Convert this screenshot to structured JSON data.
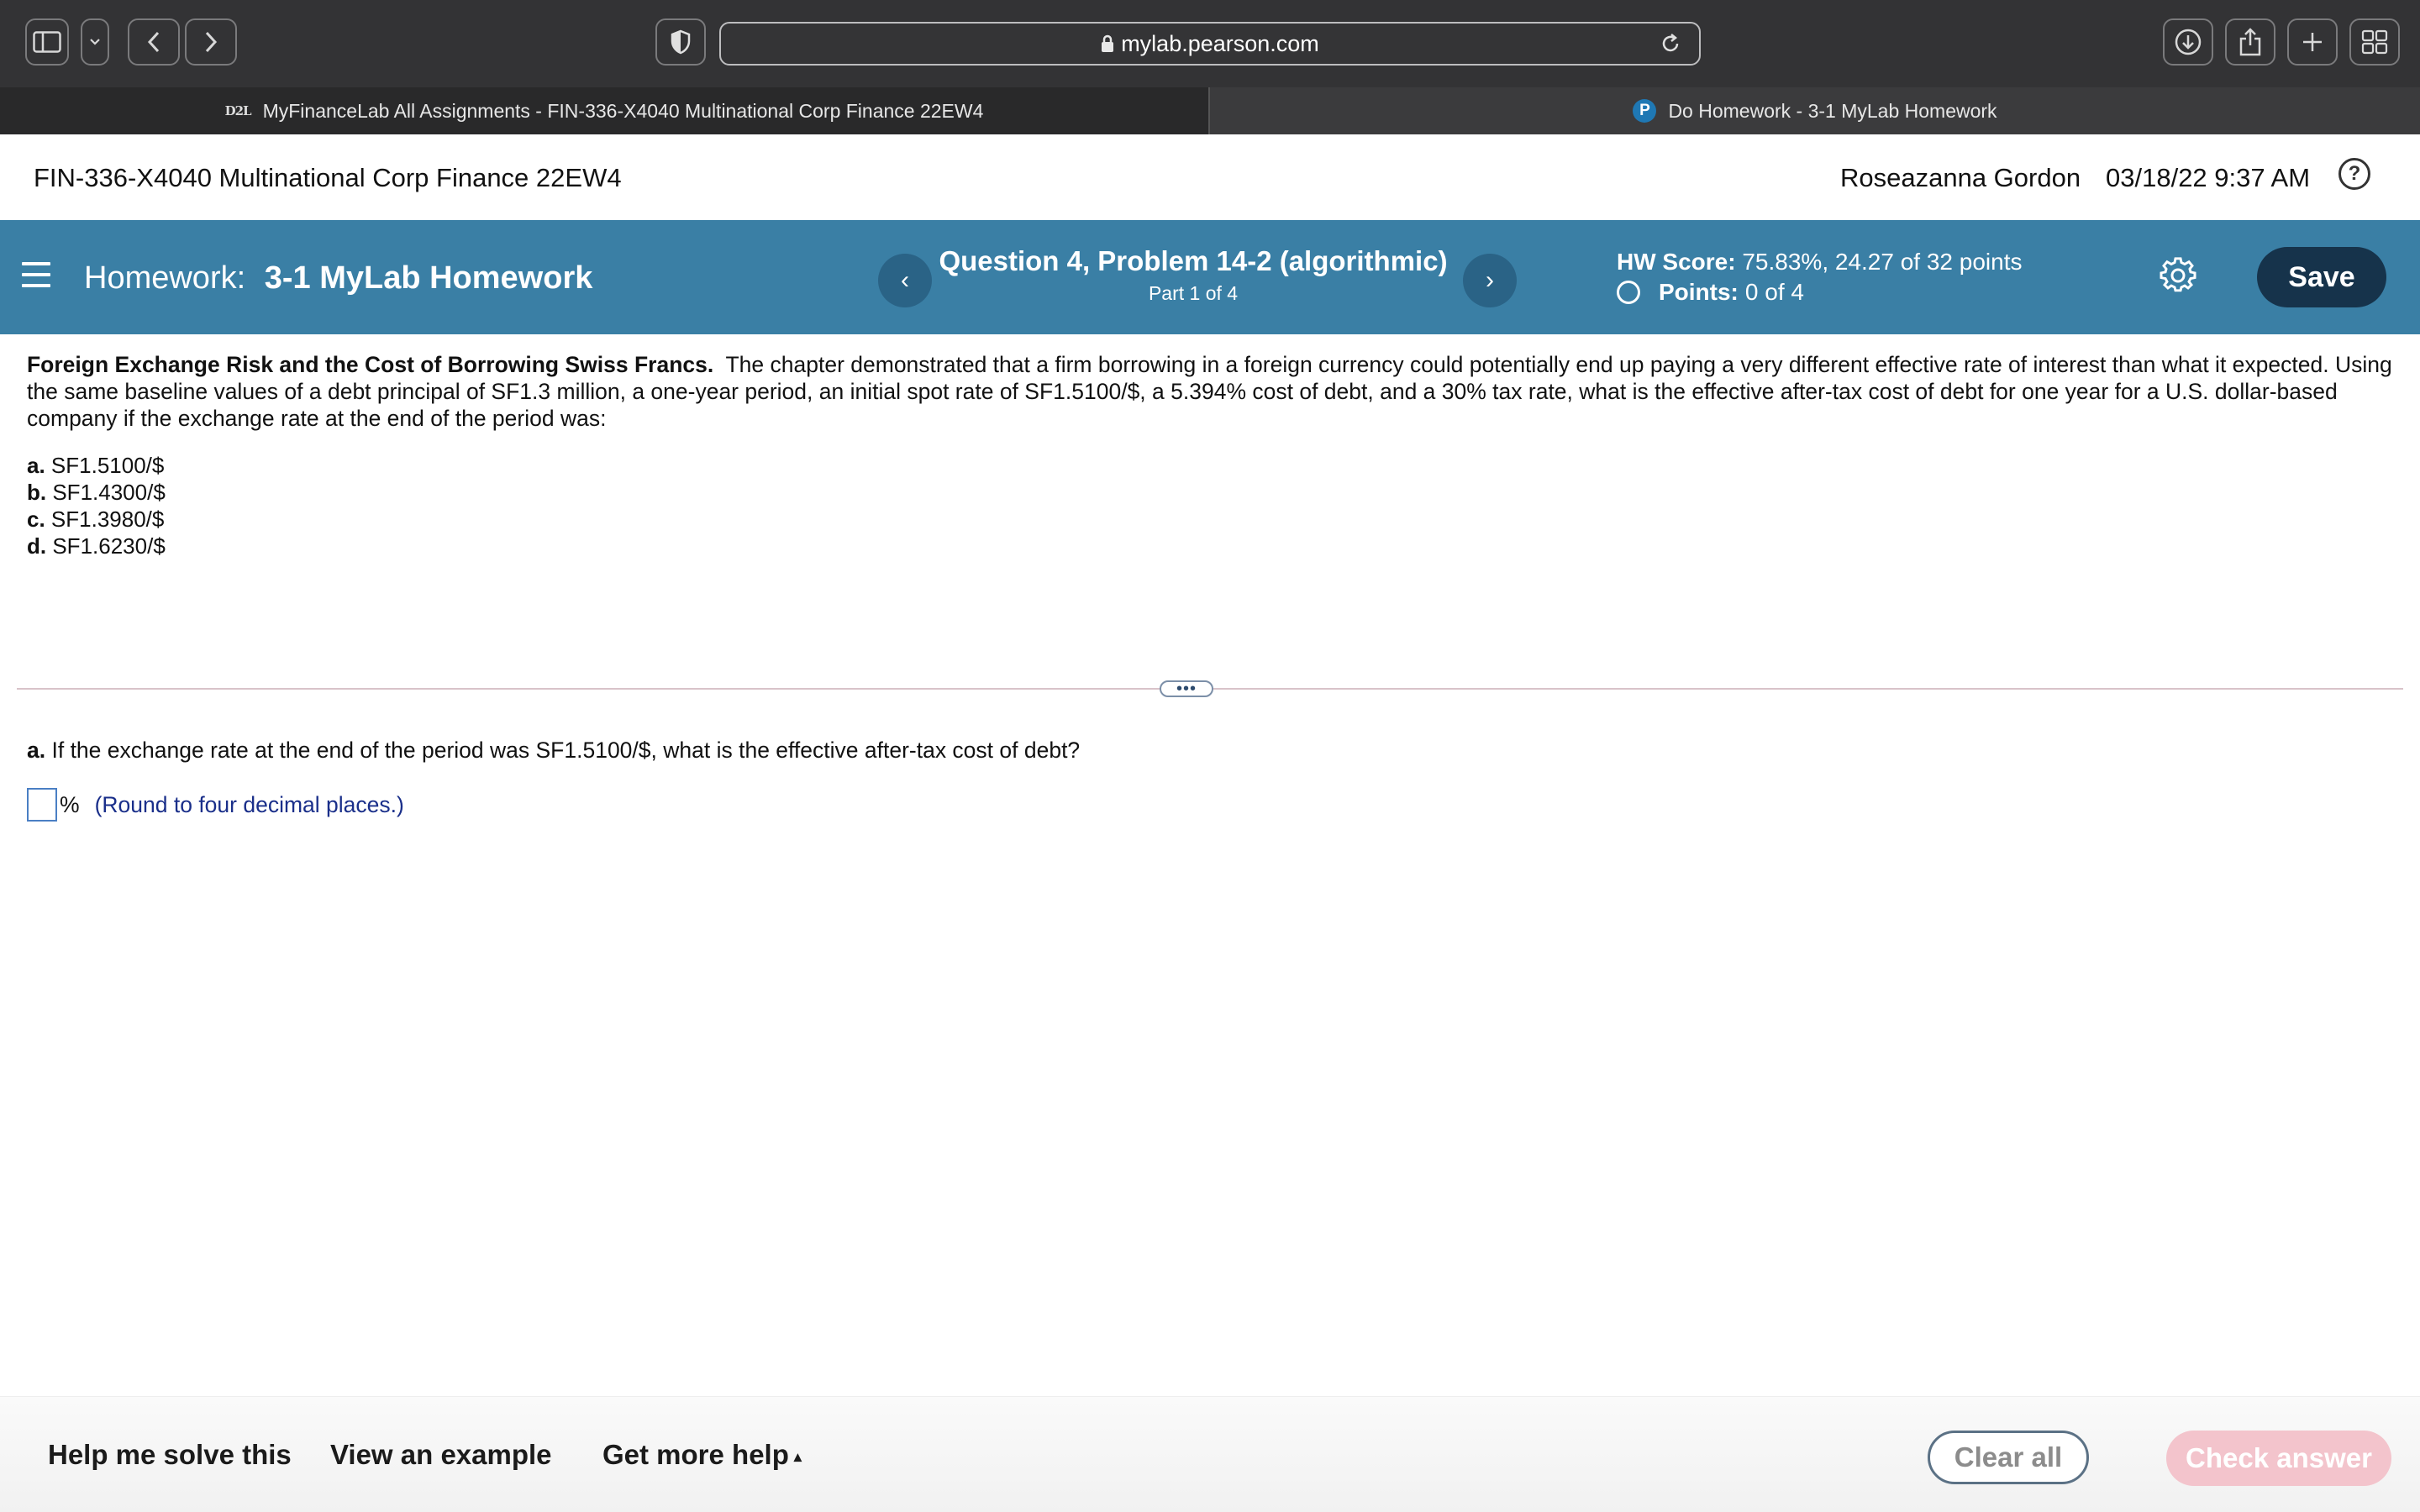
{
  "browser": {
    "url": "mylab.pearson.com",
    "tabs": [
      {
        "favicon": "D2L",
        "label": "MyFinanceLab All Assignments - FIN-336-X4040 Multinational Corp Finance 22EW4"
      },
      {
        "favicon": "P",
        "label": "Do Homework - 3-1 MyLab Homework"
      }
    ]
  },
  "header": {
    "course": "FIN-336-X4040 Multinational Corp Finance 22EW4",
    "user": "Roseazanna Gordon",
    "datetime": "03/18/22 9:37 AM",
    "help_glyph": "?"
  },
  "hw_bar": {
    "prefix": "Homework:",
    "name": "3-1 MyLab Homework",
    "question_title": "Question 4, Problem 14-2 (algorithmic)",
    "part": "Part 1 of 4",
    "score_label": "HW Score:",
    "score_value": "75.83%, 24.27 of 32 points",
    "points_label": "Points:",
    "points_value": "0 of 4",
    "save_label": "Save",
    "prev_glyph": "‹",
    "next_glyph": "›"
  },
  "question": {
    "heading": "Foreign Exchange Risk and the Cost of Borrowing Swiss Francs.",
    "body": "The chapter demonstrated that a firm borrowing in a foreign currency could potentially end up paying a very different effective rate of interest than what it expected. Using the same baseline values of a debt principal of SF1.3 million, a one-year period, an initial spot rate of SF1.5100/$, a 5.394% cost of debt, and a 30% tax rate, what is the effective after-tax cost of debt for one year for a U.S. dollar-based company if the exchange rate at the end of the period was:",
    "options": [
      {
        "letter": "a.",
        "text": "SF1.5100/$"
      },
      {
        "letter": "b.",
        "text": "SF1.4300/$"
      },
      {
        "letter": "c.",
        "text": "SF1.3980/$"
      },
      {
        "letter": "d.",
        "text": "SF1.6230/$"
      }
    ]
  },
  "divider_glyph": "•••",
  "sub_question": {
    "letter": "a.",
    "text": "If the exchange rate at the end of the period was SF1.5100/$, what is the effective after-tax cost of debt?",
    "answer_value": "",
    "unit": "%",
    "hint": "(Round to four decimal places.)"
  },
  "footer": {
    "help_solve": "Help me solve this",
    "view_example": "View an example",
    "more_help": "Get more help",
    "more_help_caret": "▴",
    "clear_all": "Clear all",
    "check_answer": "Check answer"
  },
  "colors": {
    "hw_bar": "#3a7fa5",
    "save_button": "#16334b",
    "check_button_disabled": "#f3c4cc",
    "hint_text": "#1a2f8a"
  }
}
